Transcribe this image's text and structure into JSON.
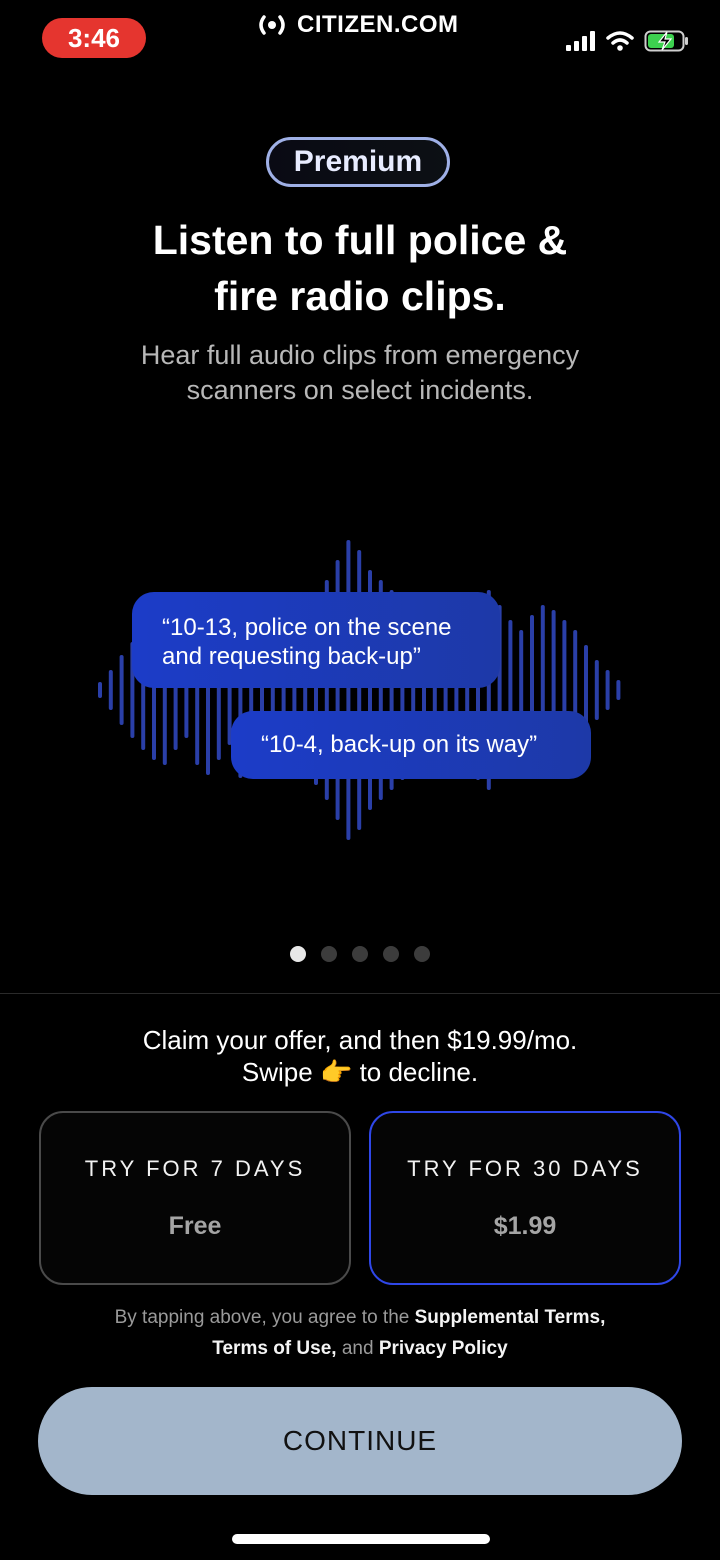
{
  "status_bar": {
    "time": "3:46",
    "brand": "CITIZEN.COM",
    "icons": [
      "signal-icon",
      "wifi-icon",
      "battery-charging-icon"
    ]
  },
  "header": {
    "badge": "Premium",
    "headline": "Listen to full police &\nfire radio clips.",
    "subhead": "Hear full audio clips from emergency\nscanners on select incidents."
  },
  "illustration": {
    "bubble_1": "“10-13, police on the scene\nand requesting back-up”",
    "bubble_2": "“10-4, back-up on its way”",
    "colors": {
      "wave": "#2a3fa8",
      "bubble": "#1c3cc8"
    }
  },
  "pager": {
    "total": 5,
    "active": 0
  },
  "offer": {
    "line1": "Claim your offer, and then $19.99/mo.",
    "line2_pre": "Swipe",
    "line2_post": "to decline.",
    "emoji": "👉"
  },
  "plans": [
    {
      "title": "TRY FOR 7 DAYS",
      "price": "Free",
      "selected": false
    },
    {
      "title": "TRY FOR 30 DAYS",
      "price": "$1.99",
      "selected": true
    }
  ],
  "legal": {
    "prefix": "By tapping above, you agree to the",
    "supplemental": "Supplemental Terms,",
    "terms": "Terms of Use,",
    "and": "and",
    "privacy": "Privacy Policy"
  },
  "continue_label": "CONTINUE",
  "colors": {
    "accent": "#2f47e8",
    "button": "#a3b6cb",
    "time_pill": "#e5352f"
  }
}
